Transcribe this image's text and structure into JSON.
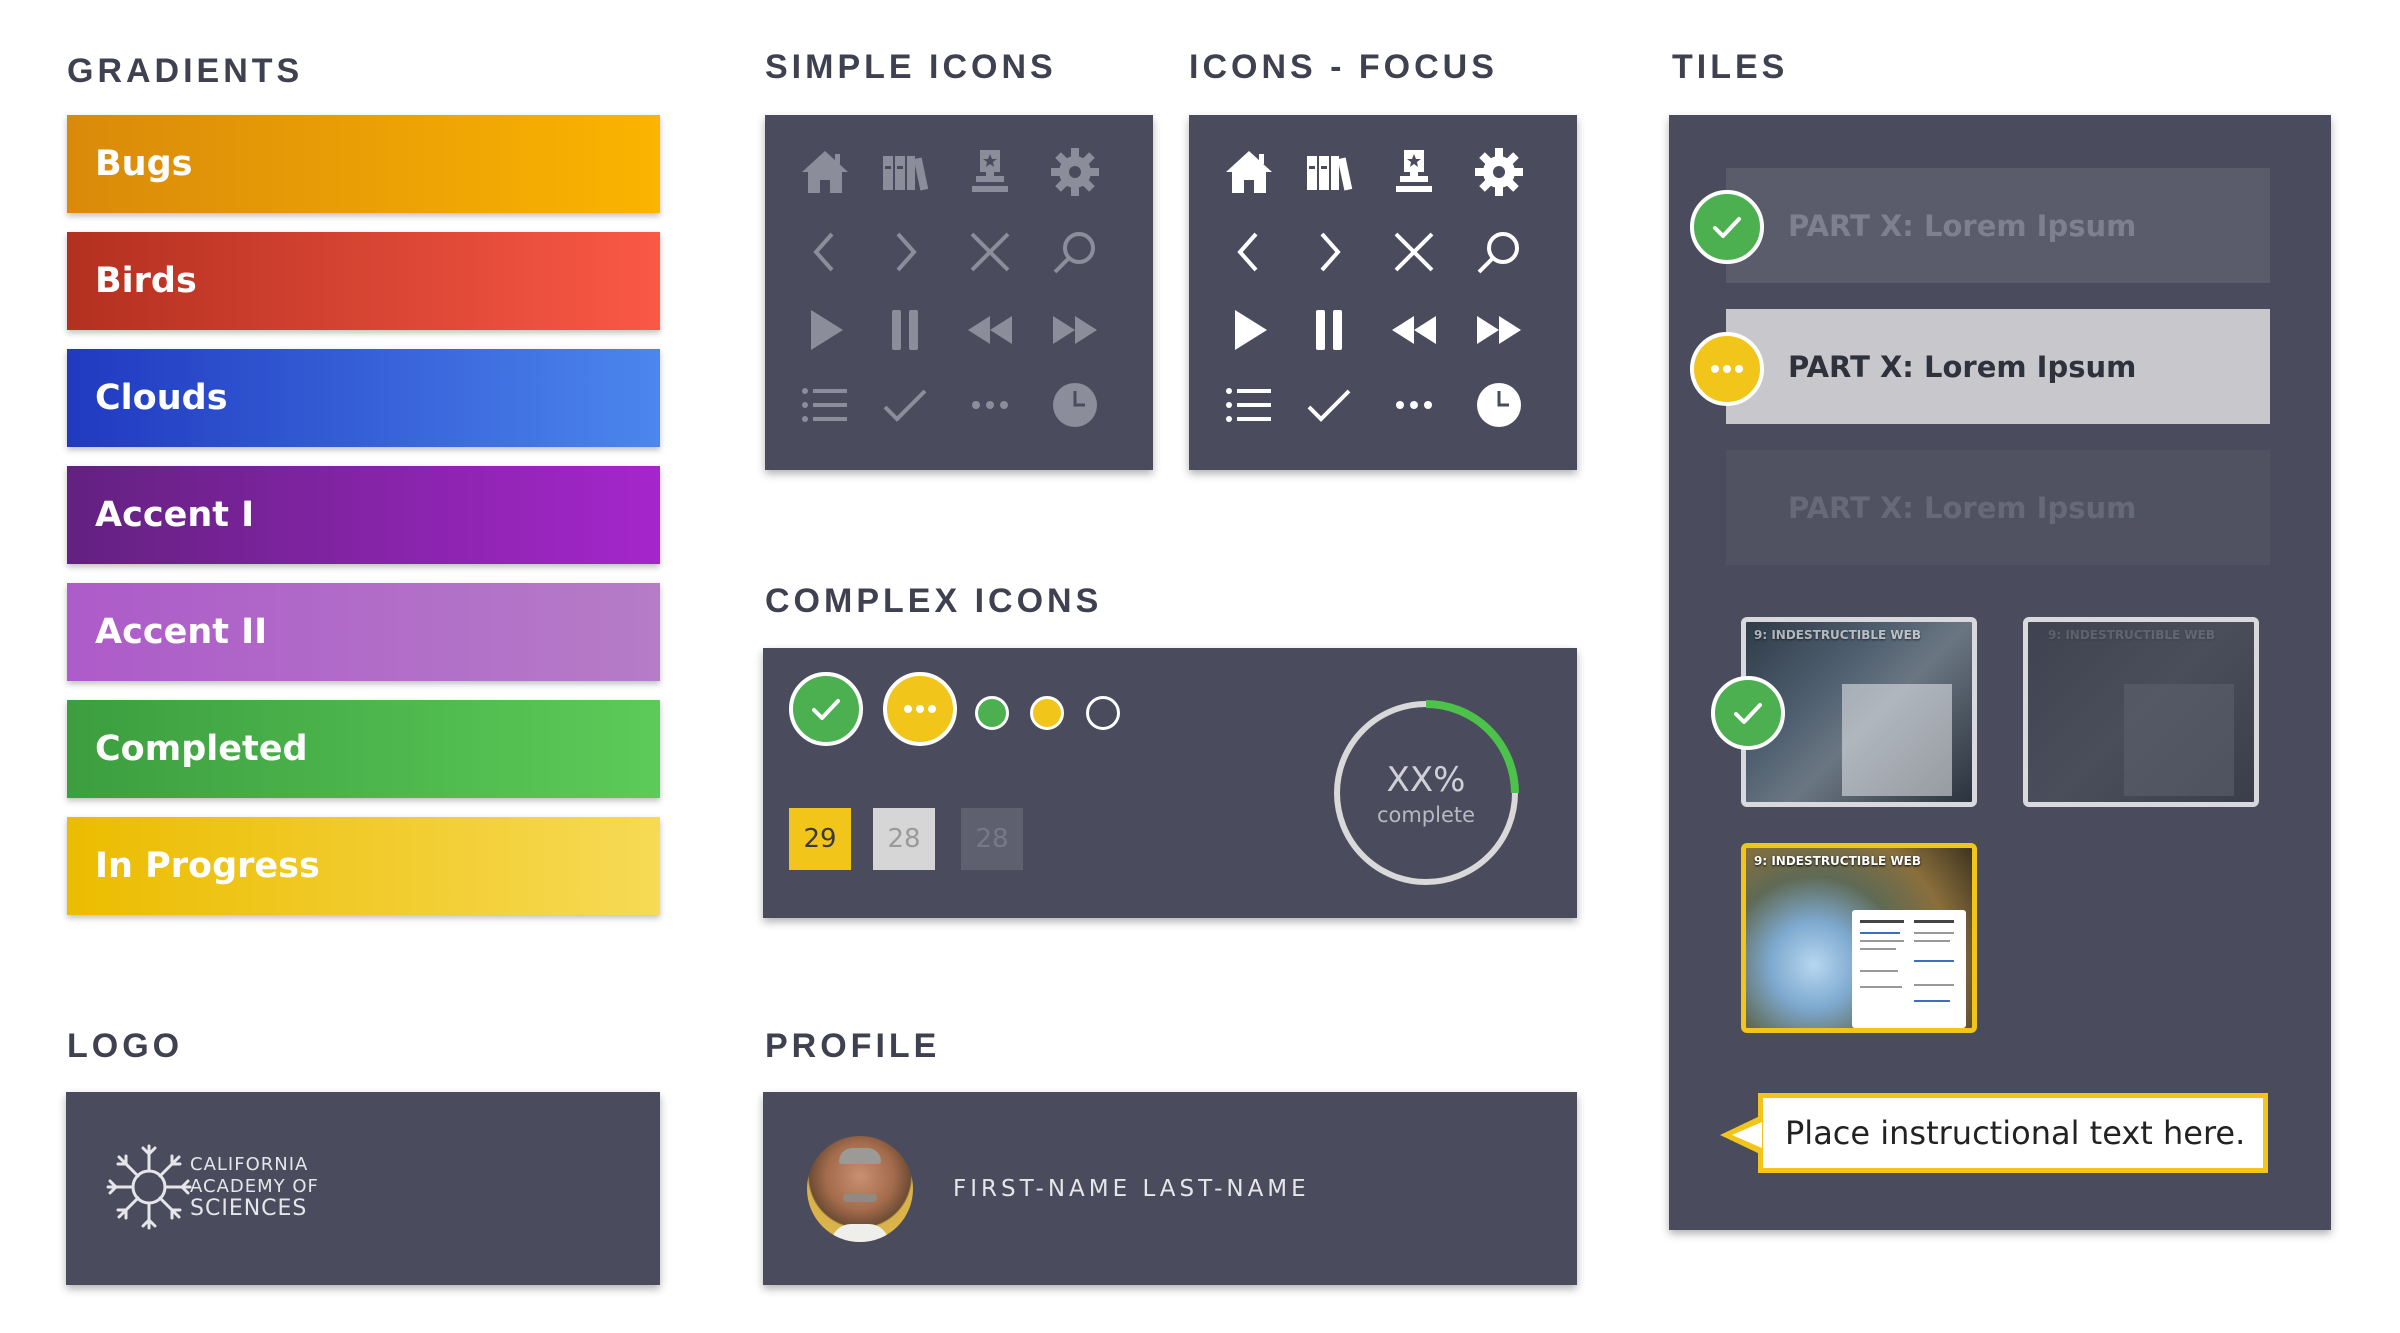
{
  "sections": {
    "gradients": "GRADIENTS",
    "simple_icons": "SIMPLE ICONS",
    "icons_focus": "ICONS - FOCUS",
    "tiles": "TILES",
    "complex_icons": "COMPLEX ICONS",
    "logo": "LOGO",
    "profile": "PROFILE"
  },
  "gradients": [
    {
      "label": "Bugs",
      "from": "#d98a0a",
      "to": "#fbb400"
    },
    {
      "label": "Birds",
      "from": "#b3301f",
      "to": "#fb5846"
    },
    {
      "label": "Clouds",
      "from": "#2039c0",
      "to": "#4c86ee"
    },
    {
      "label": "Accent I",
      "from": "#632180",
      "to": "#a526cc"
    },
    {
      "label": "Accent II",
      "from": "#ad5bc9",
      "to": "#b57cc7"
    },
    {
      "label": "Completed",
      "from": "#3c9e3f",
      "to": "#5ccb59"
    },
    {
      "label": "In Progress",
      "from": "#ebbc00",
      "to": "#f7da55"
    }
  ],
  "icon_names": [
    "home-icon",
    "books-icon",
    "award-icon",
    "gear-icon",
    "chevron-left-icon",
    "chevron-right-icon",
    "close-icon",
    "search-icon",
    "play-icon",
    "pause-icon",
    "rewind-icon",
    "fast-forward-icon",
    "list-icon",
    "check-icon",
    "more-icon",
    "clock-icon"
  ],
  "complex_icons": {
    "dates": [
      "29",
      "28",
      "28"
    ],
    "progress_value": "XX%",
    "progress_label": "complete",
    "progress_fraction": 0.25
  },
  "tiles": {
    "items": [
      {
        "label": "PART X: Lorem Ipsum",
        "state": "completed"
      },
      {
        "label": "PART X: Lorem Ipsum",
        "state": "in-progress"
      },
      {
        "label": "PART X: Lorem Ipsum",
        "state": "locked"
      }
    ],
    "thumb_title": "9: INDESTRUCTIBLE WEB",
    "instruction": "Place instructional text here."
  },
  "logo": {
    "line1": "CALIFORNIA",
    "line2": "ACADEMY OF",
    "line3": "SCIENCES"
  },
  "profile": {
    "name": "FIRST-NAME LAST-NAME"
  },
  "colors": {
    "panel": "#4a4c5d",
    "accent_yellow": "#f2c51b",
    "accent_green": "#4caf50"
  }
}
